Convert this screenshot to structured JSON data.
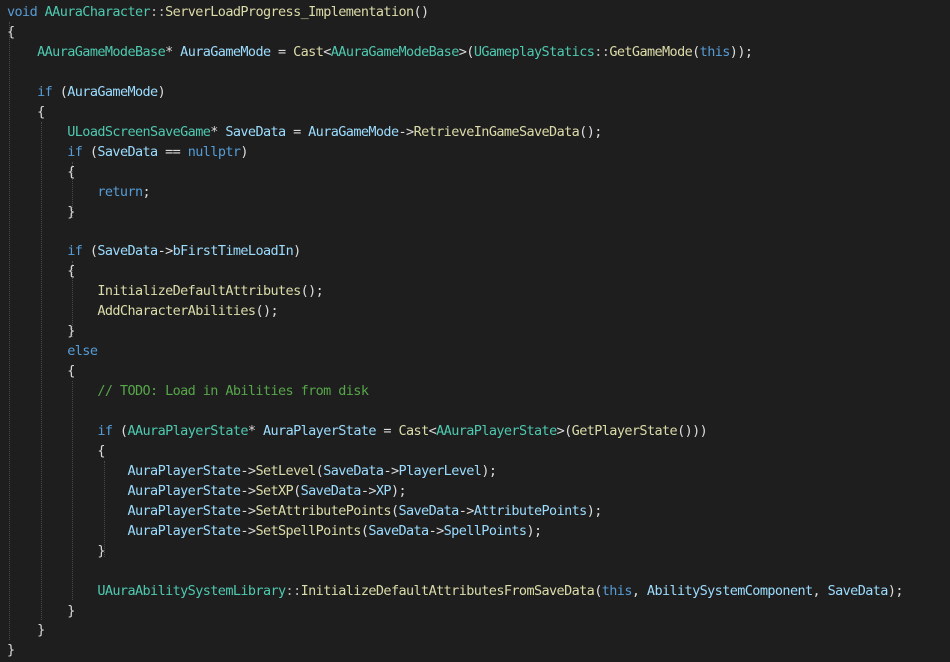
{
  "editor": {
    "lines": [
      [
        [
          "kw",
          "void"
        ],
        [
          "pl",
          " "
        ],
        [
          "ty",
          "AAuraCharacter"
        ],
        [
          "op",
          "::"
        ],
        [
          "fn",
          "ServerLoadProgress_Implementation"
        ],
        [
          "pl",
          "()"
        ]
      ],
      [
        [
          "pl",
          "{"
        ]
      ],
      [
        [
          "pl",
          "    "
        ],
        [
          "ty",
          "AAuraGameModeBase"
        ],
        [
          "pl",
          "* "
        ],
        [
          "var",
          "AuraGameMode"
        ],
        [
          "pl",
          " = "
        ],
        [
          "fn",
          "Cast"
        ],
        [
          "pl",
          "<"
        ],
        [
          "ty",
          "AAuraGameModeBase"
        ],
        [
          "pl",
          ">("
        ],
        [
          "ty",
          "UGameplayStatics"
        ],
        [
          "op",
          "::"
        ],
        [
          "fn",
          "GetGameMode"
        ],
        [
          "pl",
          "("
        ],
        [
          "kw",
          "this"
        ],
        [
          "pl",
          "));"
        ]
      ],
      [
        [
          "pl",
          ""
        ]
      ],
      [
        [
          "pl",
          "    "
        ],
        [
          "kw",
          "if"
        ],
        [
          "pl",
          " ("
        ],
        [
          "var",
          "AuraGameMode"
        ],
        [
          "pl",
          ")"
        ]
      ],
      [
        [
          "pl",
          "    {"
        ]
      ],
      [
        [
          "pl",
          "        "
        ],
        [
          "ty",
          "ULoadScreenSaveGame"
        ],
        [
          "pl",
          "* "
        ],
        [
          "var",
          "SaveData"
        ],
        [
          "pl",
          " = "
        ],
        [
          "var",
          "AuraGameMode"
        ],
        [
          "pl",
          "->"
        ],
        [
          "fn",
          "RetrieveInGameSaveData"
        ],
        [
          "pl",
          "();"
        ]
      ],
      [
        [
          "pl",
          "        "
        ],
        [
          "kw",
          "if"
        ],
        [
          "pl",
          " ("
        ],
        [
          "var",
          "SaveData"
        ],
        [
          "pl",
          " == "
        ],
        [
          "kw",
          "nullptr"
        ],
        [
          "pl",
          ")"
        ]
      ],
      [
        [
          "pl",
          "        {"
        ]
      ],
      [
        [
          "pl",
          "            "
        ],
        [
          "kw",
          "return"
        ],
        [
          "pl",
          ";"
        ]
      ],
      [
        [
          "pl",
          "        }"
        ]
      ],
      [
        [
          "pl",
          ""
        ]
      ],
      [
        [
          "pl",
          "        "
        ],
        [
          "kw",
          "if"
        ],
        [
          "pl",
          " ("
        ],
        [
          "var",
          "SaveData"
        ],
        [
          "pl",
          "->"
        ],
        [
          "var",
          "bFirstTimeLoadIn"
        ],
        [
          "pl",
          ")"
        ]
      ],
      [
        [
          "pl",
          "        {"
        ]
      ],
      [
        [
          "pl",
          "            "
        ],
        [
          "fn",
          "InitializeDefaultAttributes"
        ],
        [
          "pl",
          "();"
        ]
      ],
      [
        [
          "pl",
          "            "
        ],
        [
          "fn",
          "AddCharacterAbilities"
        ],
        [
          "pl",
          "();"
        ]
      ],
      [
        [
          "pl",
          "        }"
        ]
      ],
      [
        [
          "pl",
          "        "
        ],
        [
          "kw",
          "else"
        ]
      ],
      [
        [
          "pl",
          "        {"
        ]
      ],
      [
        [
          "pl",
          "            "
        ],
        [
          "cm",
          "// TODO: Load in Abilities from disk"
        ]
      ],
      [
        [
          "pl",
          ""
        ]
      ],
      [
        [
          "pl",
          "            "
        ],
        [
          "kw",
          "if"
        ],
        [
          "pl",
          " ("
        ],
        [
          "ty",
          "AAuraPlayerState"
        ],
        [
          "pl",
          "* "
        ],
        [
          "var",
          "AuraPlayerState"
        ],
        [
          "pl",
          " = "
        ],
        [
          "fn",
          "Cast"
        ],
        [
          "pl",
          "<"
        ],
        [
          "ty",
          "AAuraPlayerState"
        ],
        [
          "pl",
          ">("
        ],
        [
          "fn",
          "GetPlayerState"
        ],
        [
          "pl",
          "()))"
        ]
      ],
      [
        [
          "pl",
          "            {"
        ]
      ],
      [
        [
          "pl",
          "                "
        ],
        [
          "var",
          "AuraPlayerState"
        ],
        [
          "pl",
          "->"
        ],
        [
          "fn",
          "SetLevel"
        ],
        [
          "pl",
          "("
        ],
        [
          "var",
          "SaveData"
        ],
        [
          "pl",
          "->"
        ],
        [
          "var",
          "PlayerLevel"
        ],
        [
          "pl",
          ");"
        ]
      ],
      [
        [
          "pl",
          "                "
        ],
        [
          "var",
          "AuraPlayerState"
        ],
        [
          "pl",
          "->"
        ],
        [
          "fn",
          "SetXP"
        ],
        [
          "pl",
          "("
        ],
        [
          "var",
          "SaveData"
        ],
        [
          "pl",
          "->"
        ],
        [
          "var",
          "XP"
        ],
        [
          "pl",
          ");"
        ]
      ],
      [
        [
          "pl",
          "                "
        ],
        [
          "var",
          "AuraPlayerState"
        ],
        [
          "pl",
          "->"
        ],
        [
          "fn",
          "SetAttributePoints"
        ],
        [
          "pl",
          "("
        ],
        [
          "var",
          "SaveData"
        ],
        [
          "pl",
          "->"
        ],
        [
          "var",
          "AttributePoints"
        ],
        [
          "pl",
          ");"
        ]
      ],
      [
        [
          "pl",
          "                "
        ],
        [
          "var",
          "AuraPlayerState"
        ],
        [
          "pl",
          "->"
        ],
        [
          "fn",
          "SetSpellPoints"
        ],
        [
          "pl",
          "("
        ],
        [
          "var",
          "SaveData"
        ],
        [
          "pl",
          "->"
        ],
        [
          "var",
          "SpellPoints"
        ],
        [
          "pl",
          ");"
        ]
      ],
      [
        [
          "pl",
          "            }"
        ]
      ],
      [
        [
          "pl",
          ""
        ]
      ],
      [
        [
          "pl",
          "            "
        ],
        [
          "ty",
          "UAuraAbilitySystemLibrary"
        ],
        [
          "op",
          "::"
        ],
        [
          "fn",
          "InitializeDefaultAttributesFromSaveData"
        ],
        [
          "pl",
          "("
        ],
        [
          "kw",
          "this"
        ],
        [
          "pl",
          ", "
        ],
        [
          "var",
          "AbilitySystemComponent"
        ],
        [
          "pl",
          ", "
        ],
        [
          "var",
          "SaveData"
        ],
        [
          "pl",
          ");"
        ]
      ],
      [
        [
          "pl",
          "        }"
        ]
      ],
      [
        [
          "pl",
          "    }"
        ]
      ],
      [
        [
          "pl",
          "}"
        ]
      ]
    ]
  }
}
